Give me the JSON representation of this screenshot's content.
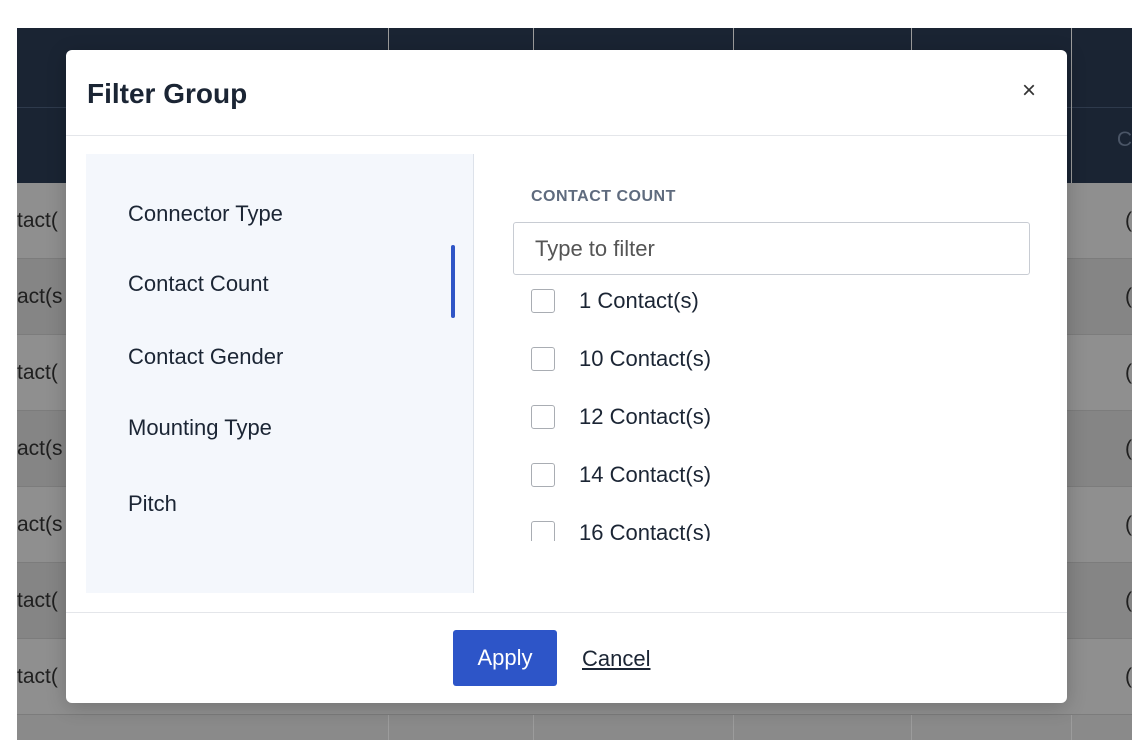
{
  "background": {
    "header_right_text": "C",
    "rows": [
      {
        "left": "tact(",
        "right": "("
      },
      {
        "left": "act(s",
        "right": "("
      },
      {
        "left": "tact(",
        "right": "("
      },
      {
        "left": "act(s",
        "right": "("
      },
      {
        "left": "act(s",
        "right": "("
      },
      {
        "left": "tact(",
        "right": "("
      },
      {
        "left": "tact(",
        "right": "("
      }
    ]
  },
  "modal": {
    "title": "Filter Group",
    "close_symbol": "×",
    "groups": [
      {
        "label": "Connector Type"
      },
      {
        "label": "Contact Count"
      },
      {
        "label": "Contact Gender"
      },
      {
        "label": "Mounting Type"
      },
      {
        "label": "Pitch"
      }
    ],
    "active_group": "Contact Count",
    "section_label": "CONTACT COUNT",
    "filter_placeholder": "Type to filter",
    "filter_value": "",
    "options": [
      {
        "label": "1 Contact(s)",
        "checked": false
      },
      {
        "label": "10 Contact(s)",
        "checked": false
      },
      {
        "label": "12 Contact(s)",
        "checked": false
      },
      {
        "label": "14 Contact(s)",
        "checked": false
      },
      {
        "label": "16 Contact(s)",
        "checked": false
      }
    ],
    "footer": {
      "apply_label": "Apply",
      "cancel_label": "Cancel"
    }
  },
  "colors": {
    "accent": "#2d55c8",
    "header_dark": "#1a2433",
    "text": "#1b2534"
  },
  "icons": {
    "close": "close-icon",
    "checkbox": "checkbox-icon"
  }
}
